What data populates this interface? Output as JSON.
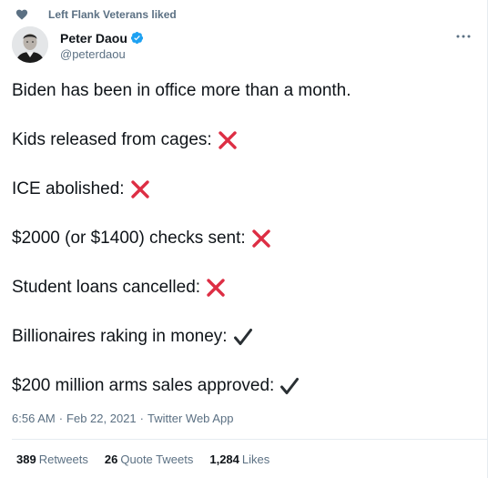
{
  "social_context": {
    "icon": "heart-icon",
    "text": "Left Flank Veterans liked"
  },
  "author": {
    "name": "Peter Daou",
    "handle": "@peterdaou",
    "verified": true,
    "verified_icon": "verified-badge-icon"
  },
  "menu": {
    "icon": "more-options-icon"
  },
  "tweet": {
    "lines": [
      {
        "text": "Biden has been in office more than a month.",
        "mark": "none"
      },
      {
        "text": "Kids released from cages:",
        "mark": "cross"
      },
      {
        "text": "ICE abolished:",
        "mark": "cross"
      },
      {
        "text": "$2000 (or $1400) checks sent:",
        "mark": "cross"
      },
      {
        "text": "Student loans cancelled:",
        "mark": "cross"
      },
      {
        "text": "Billionaires raking in money:",
        "mark": "check"
      },
      {
        "text": "$200 million arms sales approved:",
        "mark": "check"
      }
    ]
  },
  "meta": {
    "time": "6:56 AM",
    "separator": "·",
    "date": "Feb 22, 2021",
    "source": "Twitter Web App"
  },
  "stats": {
    "retweets_count": "389",
    "retweets_label": "Retweets",
    "quotes_count": "26",
    "quotes_label": "Quote Tweets",
    "likes_count": "1,284",
    "likes_label": "Likes"
  },
  "colors": {
    "cross": "#dd2e44",
    "check": "#292f33",
    "verified": "#1da1f2",
    "secondary_text": "#5b7083",
    "divider": "#e6ecf0"
  }
}
